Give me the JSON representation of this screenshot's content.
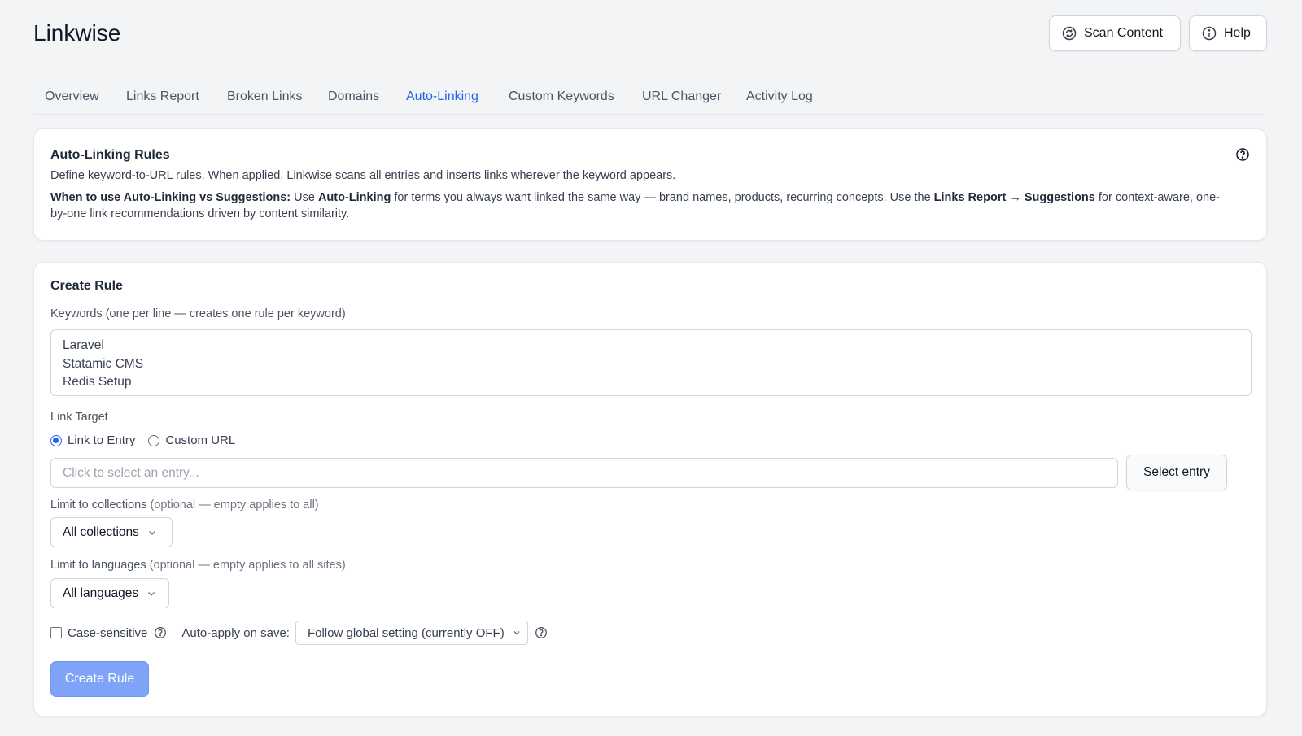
{
  "header": {
    "title": "Linkwise",
    "scan_label": "Scan Content",
    "help_label": "Help"
  },
  "tabs": [
    {
      "label": "Overview"
    },
    {
      "label": "Links Report"
    },
    {
      "label": "Broken Links"
    },
    {
      "label": "Domains"
    },
    {
      "label": "Auto-Linking",
      "active": true
    },
    {
      "label": "Custom Keywords"
    },
    {
      "label": "URL Changer"
    },
    {
      "label": "Activity Log"
    }
  ],
  "info": {
    "title": "Auto-Linking Rules",
    "description": "Define keyword-to-URL rules. When applied, Linkwise scans all entries and inserts links wherever the keyword appears.",
    "when_heading": "When to use Auto-Linking vs Suggestions:",
    "when_text_1": " Use ",
    "when_bold_1": "Auto-Linking",
    "when_text_2": " for terms you always want linked the same way — brand names, products, recurring concepts. Use the ",
    "when_bold_2": "Links Report → Suggestions",
    "when_text_3": " for context-aware, one-by-one link recommendations driven by content similarity."
  },
  "create": {
    "title": "Create Rule",
    "keywords_label": "Keywords (one per line — creates one rule per keyword)",
    "keywords": [
      "Laravel",
      "Statamic CMS",
      "Redis Setup"
    ],
    "link_target_label": "Link Target",
    "radio_entry": "Link to Entry",
    "radio_custom": "Custom URL",
    "entry_placeholder": "Click to select an entry...",
    "select_entry_label": "Select entry",
    "collections_label": "Limit to collections",
    "collections_hint": " (optional — empty applies to all)",
    "collections_value": "All collections",
    "languages_label": "Limit to languages",
    "languages_hint": " (optional — empty applies to all sites)",
    "languages_value": "All languages",
    "case_label": "Case-sensitive",
    "auto_apply_label": "Auto-apply on save:",
    "auto_apply_value": "Follow global setting (currently OFF)",
    "create_button": "Create Rule"
  },
  "colors": {
    "accent": "#2563eb",
    "primary_button": "#7fa4f7"
  }
}
